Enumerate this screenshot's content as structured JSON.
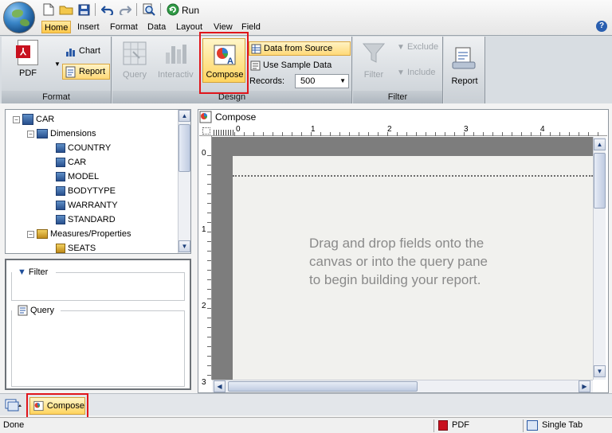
{
  "toolbar": {
    "run_label": "Run"
  },
  "menu": {
    "tabs": [
      "Home",
      "Insert",
      "Format",
      "Data",
      "Layout",
      "View",
      "Field"
    ],
    "active": "Home"
  },
  "ribbon": {
    "format": {
      "label": "Format",
      "pdf_label": "PDF",
      "chart_label": "Chart",
      "report_label": "Report"
    },
    "design": {
      "label": "Design",
      "query_label": "Query",
      "interactive_label": "Interactiv",
      "compose_label": "Compose",
      "data_from_source_label": "Data from Source",
      "use_sample_data_label": "Use Sample Data",
      "records_label": "Records:",
      "records_value": "500"
    },
    "filter": {
      "label": "Filter",
      "filter_label": "Filter",
      "exclude_label": "Exclude",
      "include_label": "Include"
    },
    "report": {
      "report_label": "Report"
    }
  },
  "tree": {
    "root": "CAR",
    "dimensions_label": "Dimensions",
    "dimensions": [
      "COUNTRY",
      "CAR",
      "MODEL",
      "BODYTYPE",
      "WARRANTY",
      "STANDARD"
    ],
    "measures_label": "Measures/Properties",
    "measures": [
      "SEATS"
    ]
  },
  "panels": {
    "filter_label": "Filter",
    "query_label": "Query"
  },
  "compose": {
    "title": "Compose",
    "ruler_h": [
      "0",
      "1",
      "2",
      "3",
      "4"
    ],
    "ruler_v": [
      "0",
      "1",
      "2",
      "3"
    ],
    "hint_lines": [
      "Drag and drop fields onto the",
      "canvas or into the query pane",
      "to begin building your report."
    ]
  },
  "bottom": {
    "compose_tab_label": "Compose"
  },
  "status": {
    "text": "Done",
    "pdf_label": "PDF",
    "single_tab_label": "Single Tab"
  },
  "colors": {
    "highlight": "#e0151b",
    "active_yellow": "#ffd45e",
    "canvas_grey": "#7d7d7d"
  }
}
